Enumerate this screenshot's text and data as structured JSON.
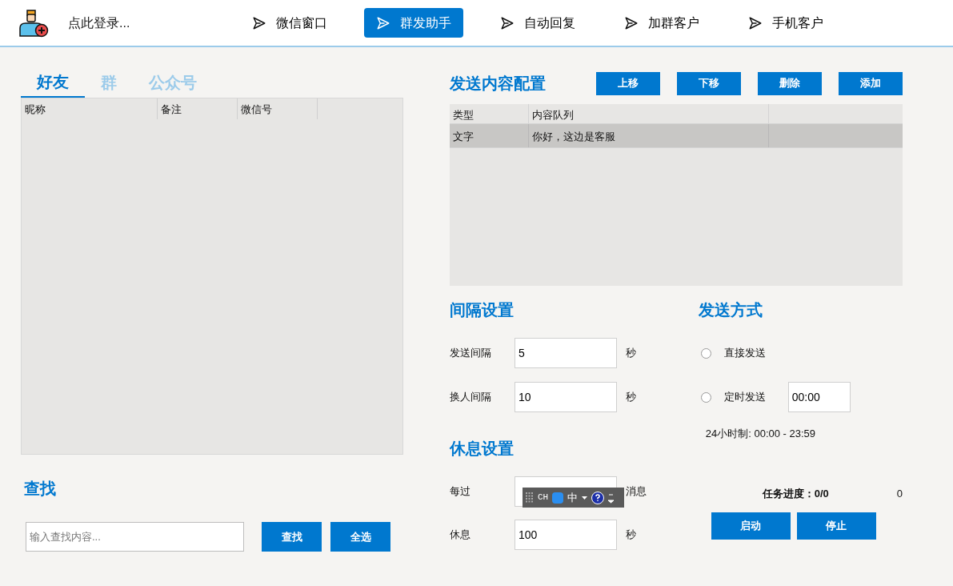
{
  "header": {
    "login": "点此登录...",
    "nav": [
      {
        "label": "微信窗口",
        "selected": false
      },
      {
        "label": "群发助手",
        "selected": true
      },
      {
        "label": "自动回复",
        "selected": false
      },
      {
        "label": "加群客户",
        "selected": false
      },
      {
        "label": "手机客户",
        "selected": false
      }
    ]
  },
  "contacts": {
    "tabs": [
      {
        "label": "好友",
        "selected": true
      },
      {
        "label": "群",
        "selected": false
      },
      {
        "label": "公众号",
        "selected": false
      }
    ],
    "columns": [
      "昵称",
      "备注",
      "微信号"
    ]
  },
  "search": {
    "title": "查找",
    "placeholder": "输入查找内容...",
    "buttons": [
      "查找",
      "全选"
    ]
  },
  "content": {
    "title": "发送内容配置",
    "buttons": [
      "上移",
      "下移",
      "删除",
      "添加"
    ],
    "columns": [
      "类型",
      "内容队列"
    ],
    "rows": [
      {
        "cells": [
          "文字",
          "你好，这边是客服"
        ],
        "selected": true
      }
    ]
  },
  "interval": {
    "title": "间隔设置",
    "rows": [
      {
        "label": "发送间隔",
        "value": "5",
        "unit": "秒"
      },
      {
        "label": "换人间隔",
        "value": "10",
        "unit": "秒"
      }
    ]
  },
  "rest": {
    "title": "休息设置",
    "rows": [
      {
        "label": "每过",
        "unit": "消息"
      },
      {
        "label": "休息",
        "value": "100",
        "unit": "秒"
      }
    ]
  },
  "send_mode": {
    "title": "发送方式",
    "options": [
      {
        "label": "直接发送",
        "selected": false
      },
      {
        "label": "定时发送",
        "selected": false,
        "time": "00:00"
      }
    ],
    "hint": "24小时制: 00:00 - 23:59"
  },
  "progress": {
    "label": "任务进度：0/0",
    "count": "0",
    "buttons": [
      "启动",
      "停止"
    ]
  },
  "ime_bar": {
    "mode": "CH",
    "lang": "中"
  }
}
